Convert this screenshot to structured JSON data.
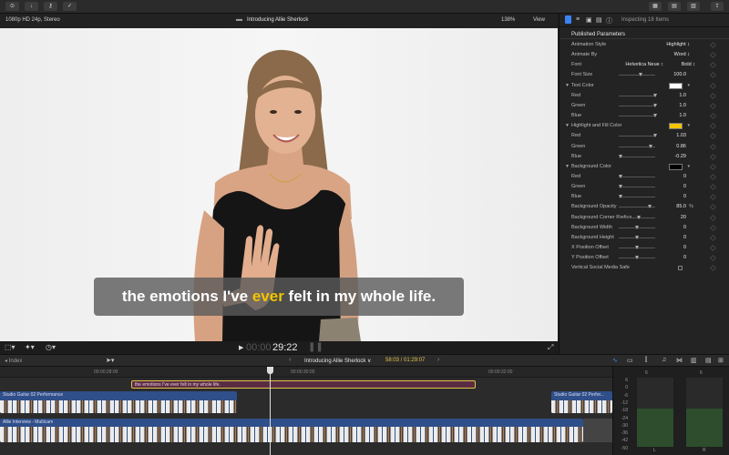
{
  "toolbar": {
    "left_icons": [
      "import-icon",
      "download-icon",
      "key-icon",
      "checkmark-icon"
    ],
    "right_icons": [
      "grid-icon",
      "browser-icon",
      "timeline-icon",
      "share-icon"
    ]
  },
  "viewer": {
    "format": "1080p HD 24p, Stereo",
    "title": "Introducing Allie Sherlock",
    "zoom": "138%",
    "view_label": "View",
    "caption_pre": "the emotions I've ",
    "caption_highlight": "ever",
    "caption_post": " felt in my whole life.",
    "timecode_dim": "00:00",
    "timecode": "29:22"
  },
  "inspector": {
    "header": "Inspecting 18 Items",
    "section": "Published Parameters",
    "rows": [
      {
        "label": "Animation Style",
        "value": "Highlight ↕",
        "type": "popup"
      },
      {
        "label": "Animate By",
        "value": "Word ↕",
        "type": "popup"
      },
      {
        "label": "Font",
        "value": "Helvetica Neue ↕",
        "value2": "Bold ↕",
        "type": "font"
      },
      {
        "label": "Font Size",
        "value": "100.0",
        "type": "slider",
        "pos": 0.6
      },
      {
        "label": "Text Color",
        "type": "color",
        "color": "#ffffff",
        "group": true
      },
      {
        "label": "Red",
        "value": "1.0",
        "type": "slider",
        "pos": 1.0
      },
      {
        "label": "Green",
        "value": "1.0",
        "type": "slider",
        "pos": 1.0
      },
      {
        "label": "Blue",
        "value": "1.0",
        "type": "slider",
        "pos": 1.0
      },
      {
        "label": "Highlight and Fill Color",
        "type": "color",
        "color": "#f2c500",
        "group": true
      },
      {
        "label": "Red",
        "value": "1.03",
        "type": "slider",
        "pos": 1.0
      },
      {
        "label": "Green",
        "value": "0.86",
        "type": "slider",
        "pos": 0.88
      },
      {
        "label": "Blue",
        "value": "-0.29",
        "type": "slider",
        "pos": 0.05
      },
      {
        "label": "Background Color",
        "type": "color",
        "color": "#000000",
        "group": true
      },
      {
        "label": "Red",
        "value": "0",
        "type": "slider",
        "pos": 0.05
      },
      {
        "label": "Green",
        "value": "0",
        "type": "slider",
        "pos": 0.05
      },
      {
        "label": "Blue",
        "value": "0",
        "type": "slider",
        "pos": 0.05
      },
      {
        "label": "Background Opacity",
        "value": "85.0",
        "unit": "%",
        "type": "slider",
        "pos": 0.85
      },
      {
        "label": "Background Corner Radius",
        "value": "20",
        "type": "slider",
        "pos": 0.55
      },
      {
        "label": "Background Width",
        "value": "0",
        "type": "slider",
        "pos": 0.5
      },
      {
        "label": "Background Height",
        "value": "0",
        "type": "slider",
        "pos": 0.5
      },
      {
        "label": "X Position Offset",
        "value": "0",
        "type": "slider",
        "pos": 0.5
      },
      {
        "label": "Y Position Offset",
        "value": "0",
        "type": "slider",
        "pos": 0.5
      },
      {
        "label": "Vertical Social Media Safe",
        "type": "checkbox",
        "checked": false
      }
    ]
  },
  "timeline": {
    "index_label": "Index",
    "project_title": "Introducing Allie Sherlock ∨",
    "duration": "58:03 / 01:29:07",
    "ruler": [
      "00:00:28:00",
      "00:00:30:00",
      "00:00:32:00"
    ],
    "caption_clip": "the emotions I've ever felt in my whole life.",
    "music_clip_a": "Studio Guitar 02 Performance",
    "music_clip_b": "Studio Guitar 02 Perfor...",
    "video_clip": "Allie Interview - Multicam"
  },
  "meters": {
    "scale": [
      "6",
      "0",
      "-6",
      "-12",
      "-18",
      "-24",
      "-30",
      "-36",
      "-42",
      "-50"
    ],
    "top_left": "6",
    "top_right": "6",
    "left_label": "L",
    "right_label": "R"
  }
}
